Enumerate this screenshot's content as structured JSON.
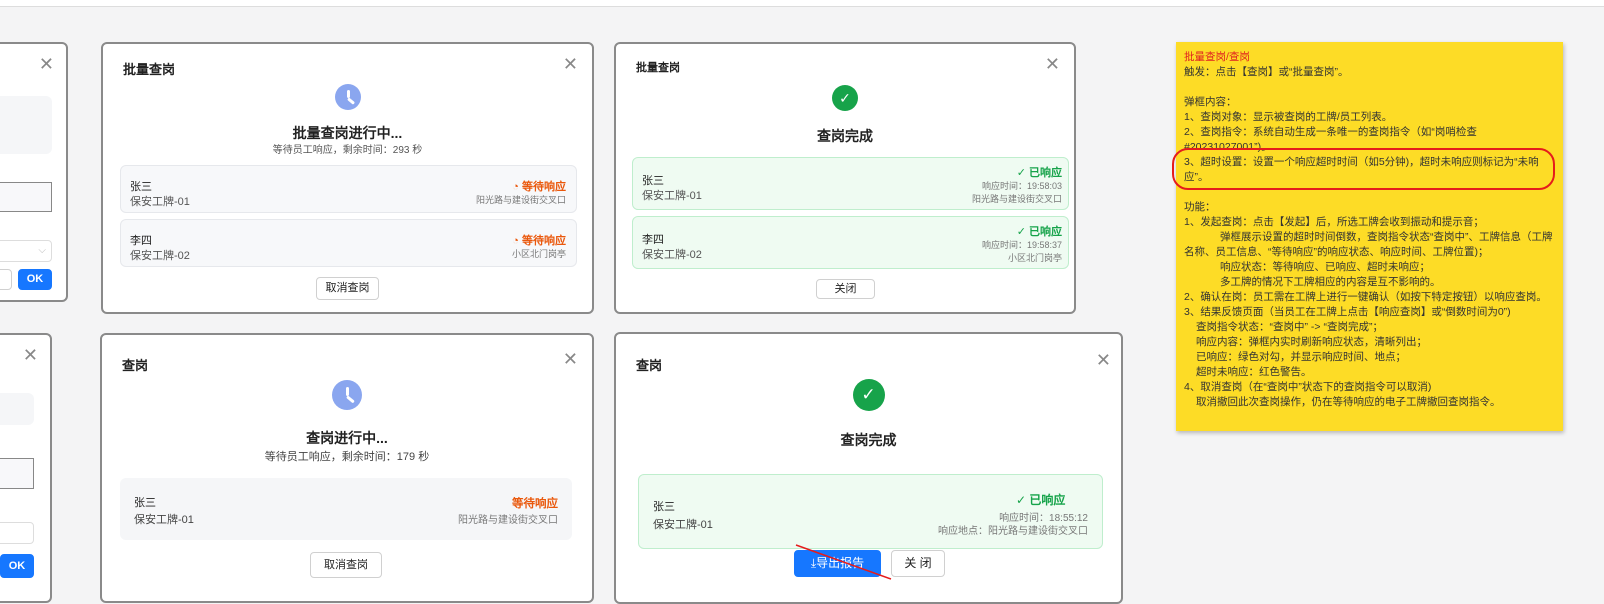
{
  "left_partial": {
    "ok_label": "OK"
  },
  "batch_progress": {
    "title": "批量查岗",
    "status_title": "批量查岗进行中...",
    "countdown": "等待员工响应，剩余时间：293 秒",
    "items": [
      {
        "name": "张三",
        "badge": "保安工牌-01",
        "status": "等待响应",
        "location": "阳光路与建设街交叉口"
      },
      {
        "name": "李四",
        "badge": "保安工牌-02",
        "status": "等待响应",
        "location": "小区北门岗亭"
      }
    ],
    "cancel_label": "取消查岗"
  },
  "batch_done": {
    "title": "批量查岗",
    "status_title": "查岗完成",
    "items": [
      {
        "name": "张三",
        "badge": "保安工牌-01",
        "status": "✓ 已响应",
        "time": "响应时间：19:58:03",
        "location": "阳光路与建设街交叉口"
      },
      {
        "name": "李四",
        "badge": "保安工牌-02",
        "status": "✓ 已响应",
        "time": "响应时间：19:58:37",
        "location": "小区北门岗亭"
      }
    ],
    "close_label": "关闭"
  },
  "single_progress": {
    "title": "查岗",
    "status_title": "查岗进行中...",
    "countdown": "等待员工响应，剩余时间：179 秒",
    "item": {
      "name": "张三",
      "badge": "保安工牌-01",
      "status": "等待响应",
      "location": "阳光路与建设街交叉口"
    },
    "cancel_label": "取消查岗"
  },
  "single_done": {
    "title": "查岗",
    "status_title": "查岗完成",
    "item": {
      "name": "张三",
      "badge": "保安工牌-01",
      "status": "✓ 已响应",
      "time": "响应时间：18:55:12",
      "location": "响应地点：阳光路与建设街交叉口"
    },
    "export_label": "导出报告",
    "close_label": "关 闭"
  },
  "note": {
    "lines": [
      "批量查岗/查岗",
      "触发：点击【查岗】或“批量查岗”。",
      "",
      "弹框内容：",
      "1、查岗对象：显示被查岗的工牌/员工列表。",
      "2、查岗指令：系统自动生成一条唯一的查岗指令（如“岗哨检查#20231027001”)。",
      "3、超时设置：设置一个响应超时时间（如5分钟)，超时未响应则标记为“未响应”。",
      "",
      "功能：",
      "1、发起查岗：点击【发起】后，所选工牌会收到振动和提示音；",
      "弹框展示设置的超时时间倒数，查岗指令状态“查岗中”、工牌信息（工牌名称、员工信息、“等待响应”的响应状态、响应时间、工牌位置)；",
      "响应状态：等待响应、已响应、超时未响应；",
      "多工牌的情况下工牌相应的内容是互不影响的。",
      "2、确认在岗：员工需在工牌上进行一键确认（如按下特定按钮）以响应查岗。",
      "3、结果反馈页面（当员工在工牌上点击【响应查岗】或“倒数时间为0”)",
      "查岗指令状态：“查岗中” -> “查岗完成”；",
      "响应内容：弹框内实时刷新响应状态，清晰列出；",
      "已响应：绿色对勾，并显示响应时间、地点；",
      "超时未响应：红色警告。",
      "4、取消查岗（在“查岗中”状态下的查岗指令可以取消)",
      "取消撤回此次查岗操作，仍在等待响应的电子工牌撤回查岗指令。"
    ]
  },
  "colors": {
    "accent": "#1677ff",
    "wait": "#ea580c",
    "done": "#16a34a",
    "note_bg": "#fddc26",
    "annotation": "#e51c1c"
  }
}
